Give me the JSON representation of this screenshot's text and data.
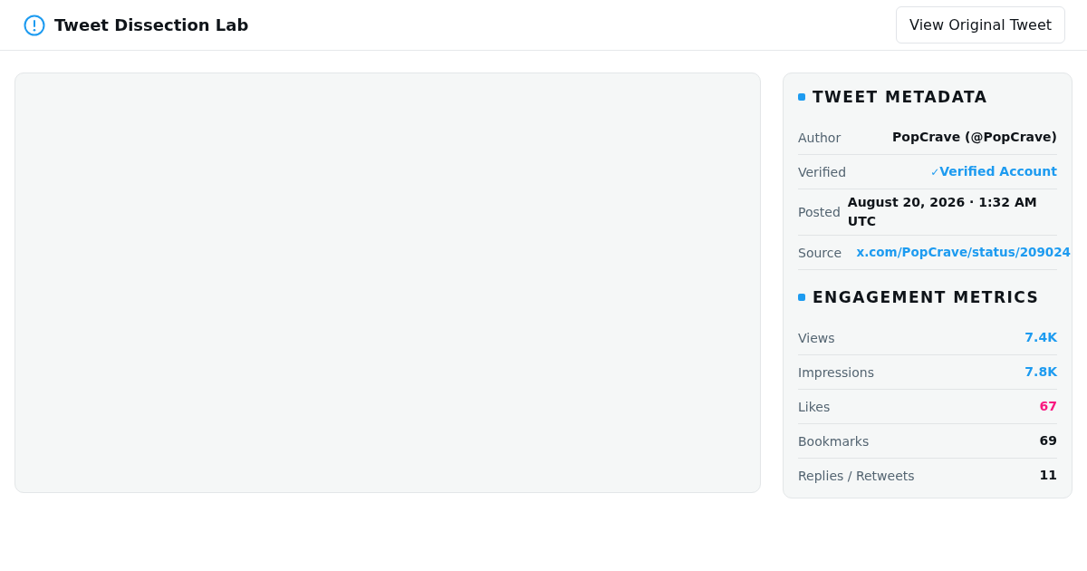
{
  "header": {
    "title": "Tweet Dissection Lab",
    "button": "View Original Tweet"
  },
  "metadata": {
    "title": "TWEET METADATA",
    "rows": [
      {
        "kind": "text",
        "label": "Author",
        "value": "PopCrave (@PopCrave)"
      },
      {
        "kind": "verified",
        "label": "Verified",
        "value": "Verified Account",
        "check": "✓",
        "verified": true
      },
      {
        "kind": "text",
        "label": "Posted",
        "value": "August 20, 2026 · 1:32 AM UTC"
      },
      {
        "kind": "link",
        "label": "Source",
        "value": "x.com/PopCrave/status/209024"
      }
    ]
  },
  "engagement": {
    "title": "ENGAGEMENT METRICS",
    "rows": [
      {
        "label": "Views",
        "value": "7.4K",
        "color": "#1d9bf0"
      },
      {
        "label": "Impressions",
        "value": "7.8K",
        "color": "#1d9bf0"
      },
      {
        "label": "Likes",
        "value": "67",
        "color": "#f91880"
      },
      {
        "label": "Bookmarks",
        "value": "69",
        "color": "#0f1419"
      },
      {
        "label": "Replies / Retweets",
        "value": "11",
        "color": "#0f1419"
      }
    ]
  }
}
